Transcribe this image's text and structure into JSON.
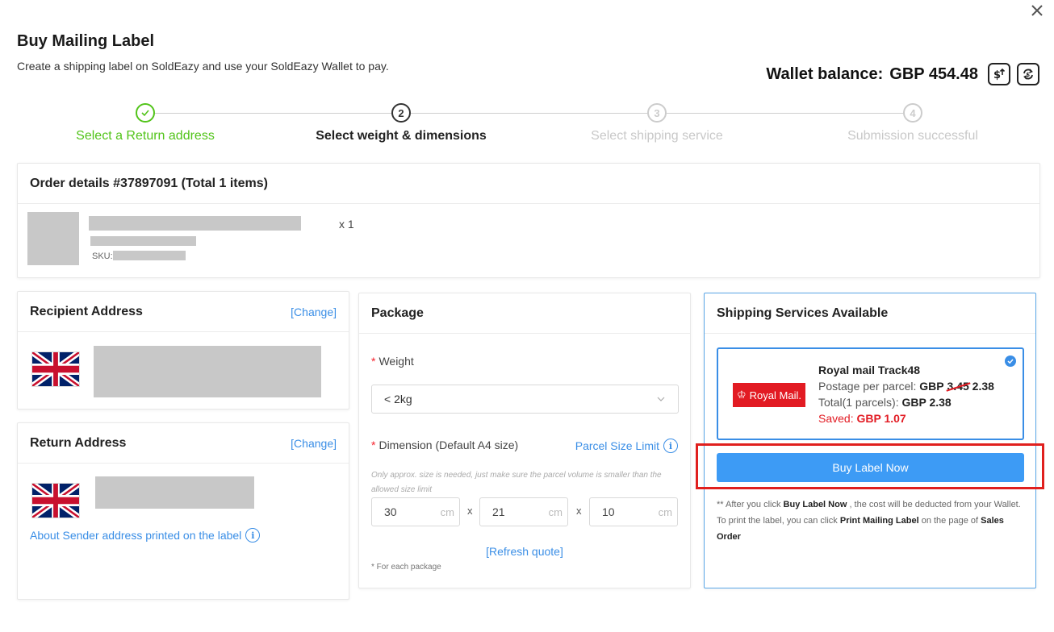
{
  "dialog": {
    "title": "Buy Mailing Label",
    "subtitle": "Create a shipping label on SoldEazy and use your SoldEazy Wallet to pay.",
    "close_icon": "close-icon"
  },
  "wallet": {
    "label": "Wallet balance:",
    "value": "GBP 454.48",
    "topup_icon": "dollar-topup-icon",
    "refresh_icon": "refresh-icon"
  },
  "steps": [
    {
      "number": "1",
      "label": "Select a Return address",
      "state": "done"
    },
    {
      "number": "2",
      "label": "Select weight & dimensions",
      "state": "active"
    },
    {
      "number": "3",
      "label": "Select shipping service",
      "state": "pending"
    },
    {
      "number": "4",
      "label": "Submission successful",
      "state": "pending"
    }
  ],
  "order": {
    "title": "Order details #37897091 (Total 1 items)",
    "item": {
      "sku_label": "SKU:",
      "quantity": "x 1"
    }
  },
  "recipient": {
    "title": "Recipient Address",
    "change_label": "[Change]",
    "flag": "uk-flag-icon"
  },
  "return_address": {
    "title": "Return Address",
    "change_label": "[Change]",
    "flag": "uk-flag-icon",
    "sender_link": "About Sender address printed on the label"
  },
  "package": {
    "title": "Package",
    "weight_label": "Weight",
    "weight_value": "< 2kg",
    "dimension_label": "Dimension (Default A4 size)",
    "parcel_link": "Parcel Size Limit",
    "hint": "Only approx. size is needed, just make sure the parcel volume is smaller than the allowed size limit",
    "length": "30",
    "width": "21",
    "height": "10",
    "unit": "cm",
    "times": "x",
    "refresh": "[Refresh quote]",
    "each_note": "* For each package"
  },
  "shipping": {
    "title": "Shipping Services Available",
    "service": {
      "logo_text": "Royal Mail.",
      "name": "Royal mail Track48",
      "postage_label": "Postage per parcel:",
      "currency": "GBP",
      "old_price": "3.45",
      "new_price": "2.38",
      "total_label": "Total(1 parcels):",
      "total_value": "GBP 2.38",
      "saved_label": "Saved:",
      "saved_value": "GBP 1.07",
      "selected": true
    },
    "buy_button": "Buy Label Now",
    "note_prefix": "** After you click ",
    "note_buy": "Buy Label Now",
    "note_mid": " , the cost will be deducted from your Wallet. To print the label, you can click ",
    "note_print": "Print Mailing Label",
    "note_end": " on the page of ",
    "note_sales": "Sales Order"
  },
  "colors": {
    "accent": "#3d9bf5",
    "success": "#52c41a",
    "danger": "#e21b23",
    "highlight": "#e0201e"
  }
}
